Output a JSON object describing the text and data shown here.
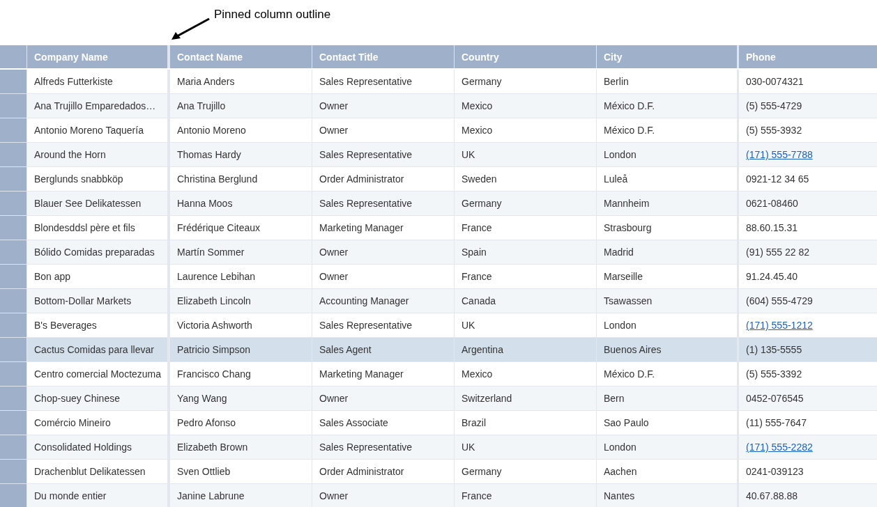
{
  "annotation": {
    "text": "Pinned column outline"
  },
  "columns": [
    {
      "label": "Company Name",
      "pinned": true
    },
    {
      "label": "Contact Name",
      "pinned": false
    },
    {
      "label": "Contact Title",
      "pinned": false
    },
    {
      "label": "Country",
      "pinned": false
    },
    {
      "label": "City",
      "pinned": false
    },
    {
      "label": "Phone",
      "pinned": true
    }
  ],
  "rows": [
    {
      "selected": false,
      "cells": [
        "Alfreds Futterkiste",
        "Maria Anders",
        "Sales Representative",
        "Germany",
        "Berlin"
      ],
      "phone": {
        "kind": "text",
        "text": "030-0074321"
      }
    },
    {
      "selected": false,
      "cells": [
        "Ana Trujillo Emparedados…",
        "Ana Trujillo",
        "Owner",
        "Mexico",
        "México D.F."
      ],
      "phone": {
        "kind": "text",
        "text": "(5) 555-4729"
      }
    },
    {
      "selected": false,
      "cells": [
        "Antonio Moreno Taquería",
        "Antonio Moreno",
        "Owner",
        "Mexico",
        "México D.F."
      ],
      "phone": {
        "kind": "text",
        "text": "(5) 555-3932"
      }
    },
    {
      "selected": false,
      "cells": [
        "Around the Horn",
        "Thomas Hardy",
        "Sales Representative",
        "UK",
        "London"
      ],
      "phone": {
        "kind": "link",
        "text": "(171) 555-7788"
      }
    },
    {
      "selected": false,
      "cells": [
        "Berglunds snabbköp",
        "Christina Berglund",
        "Order Administrator",
        "Sweden",
        "Luleå"
      ],
      "phone": {
        "kind": "text",
        "text": "0921-12 34 65"
      }
    },
    {
      "selected": false,
      "cells": [
        "Blauer See Delikatessen",
        "Hanna Moos",
        "Sales Representative",
        "Germany",
        "Mannheim"
      ],
      "phone": {
        "kind": "text",
        "text": "0621-08460"
      }
    },
    {
      "selected": false,
      "cells": [
        "Blondesddsl père et fils",
        "Frédérique Citeaux",
        "Marketing Manager",
        "France",
        "Strasbourg"
      ],
      "phone": {
        "kind": "text",
        "text": "88.60.15.31"
      }
    },
    {
      "selected": false,
      "cells": [
        "Bólido Comidas preparadas",
        "Martín Sommer",
        "Owner",
        "Spain",
        "Madrid"
      ],
      "phone": {
        "kind": "text",
        "text": "(91) 555 22 82"
      }
    },
    {
      "selected": false,
      "cells": [
        "Bon app",
        "Laurence Lebihan",
        "Owner",
        "France",
        "Marseille"
      ],
      "phone": {
        "kind": "text",
        "text": "91.24.45.40"
      }
    },
    {
      "selected": false,
      "cells": [
        "Bottom-Dollar Markets",
        "Elizabeth Lincoln",
        "Accounting Manager",
        "Canada",
        "Tsawassen"
      ],
      "phone": {
        "kind": "text",
        "text": "(604) 555-4729"
      }
    },
    {
      "selected": false,
      "cells": [
        "B's Beverages",
        "Victoria Ashworth",
        "Sales Representative",
        "UK",
        "London"
      ],
      "phone": {
        "kind": "link",
        "text": "(171) 555-1212"
      }
    },
    {
      "selected": true,
      "cells": [
        "Cactus Comidas para llevar",
        "Patricio Simpson",
        "Sales Agent",
        "Argentina",
        "Buenos Aires"
      ],
      "phone": {
        "kind": "text",
        "text": "(1) 135-5555"
      }
    },
    {
      "selected": false,
      "cells": [
        "Centro comercial Moctezuma",
        "Francisco Chang",
        "Marketing Manager",
        "Mexico",
        "México D.F."
      ],
      "phone": {
        "kind": "text",
        "text": "(5) 555-3392"
      }
    },
    {
      "selected": false,
      "cells": [
        "Chop-suey Chinese",
        "Yang Wang",
        "Owner",
        "Switzerland",
        "Bern"
      ],
      "phone": {
        "kind": "text",
        "text": "0452-076545"
      }
    },
    {
      "selected": false,
      "cells": [
        "Comércio Mineiro",
        "Pedro Afonso",
        "Sales Associate",
        "Brazil",
        "Sao Paulo"
      ],
      "phone": {
        "kind": "text",
        "text": "(11) 555-7647"
      }
    },
    {
      "selected": false,
      "cells": [
        "Consolidated Holdings",
        "Elizabeth Brown",
        "Sales Representative",
        "UK",
        "London"
      ],
      "phone": {
        "kind": "link",
        "text": "(171) 555-2282"
      }
    },
    {
      "selected": false,
      "cells": [
        "Drachenblut Delikatessen",
        "Sven Ottlieb",
        "Order Administrator",
        "Germany",
        "Aachen"
      ],
      "phone": {
        "kind": "text",
        "text": "0241-039123"
      }
    },
    {
      "selected": false,
      "cells": [
        "Du monde entier",
        "Janine Labrune",
        "Owner",
        "France",
        "Nantes"
      ],
      "phone": {
        "kind": "text",
        "text": "40.67.88.88"
      }
    }
  ]
}
